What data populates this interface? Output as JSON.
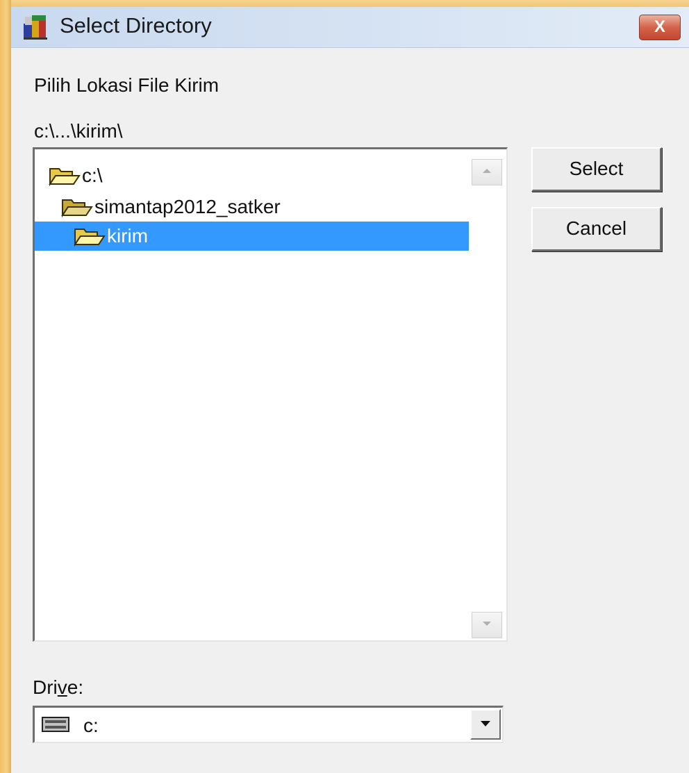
{
  "window": {
    "title": "Select Directory",
    "close_label": "X"
  },
  "dialog": {
    "prompt": "Pilih Lokasi File Kirim",
    "current_path": "c:\\...\\kirim\\"
  },
  "tree": {
    "items": [
      {
        "label": "c:\\",
        "icon": "open-folder-icon",
        "selected": false
      },
      {
        "label": "simantap2012_satker",
        "icon": "open-folder-icon",
        "selected": false
      },
      {
        "label": "kirim",
        "icon": "open-folder-icon",
        "selected": true
      }
    ]
  },
  "buttons": {
    "select": "Select",
    "cancel": "Cancel"
  },
  "drive": {
    "label_before": "Dri",
    "label_mnemonic": "v",
    "label_after": "e:",
    "value": "c:",
    "icon": "hard-drive-icon"
  },
  "colors": {
    "selection": "#3399ff",
    "dialog_bg": "#f0f0f0",
    "close_button": "#d4634b"
  }
}
